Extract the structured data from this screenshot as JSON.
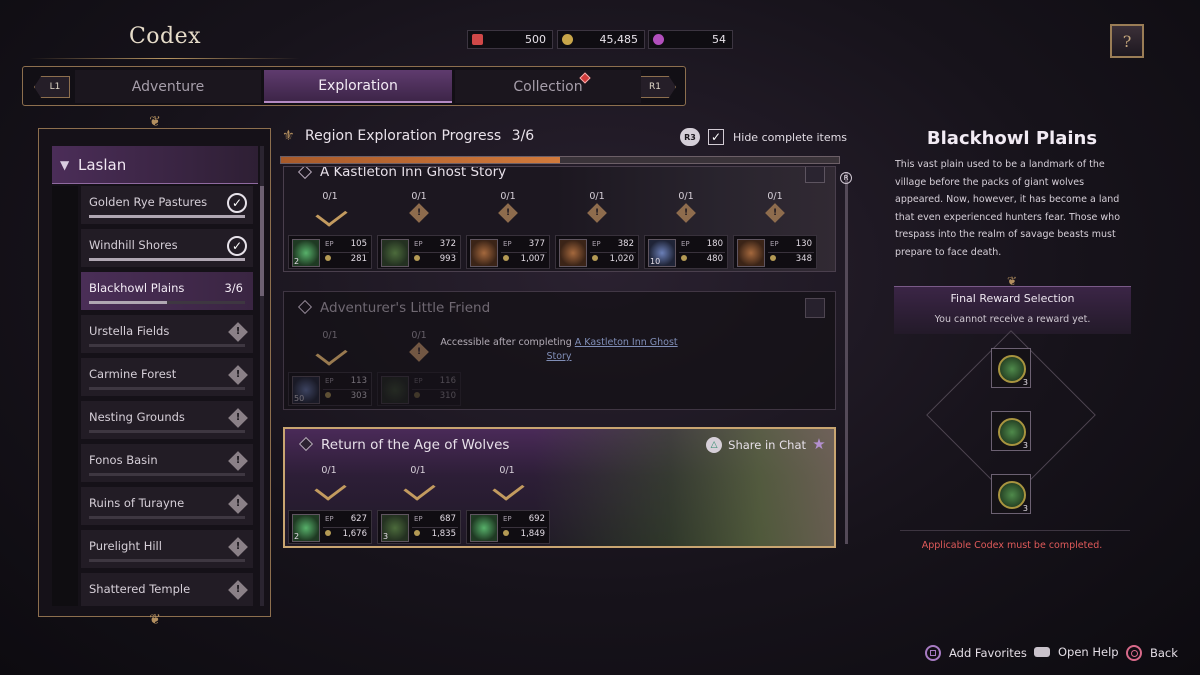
{
  "header": {
    "title": "Codex",
    "currencies": [
      {
        "icon": "flag-icon",
        "value": "500",
        "color": "#d04848"
      },
      {
        "icon": "gil-coin-icon",
        "value": "45,485",
        "color": "#c8a64a"
      },
      {
        "icon": "gem-icon",
        "value": "54",
        "color": "#b24fbd"
      }
    ],
    "help_icon": "help-book-icon"
  },
  "tabs": {
    "left_shoulder": "L1",
    "right_shoulder": "R1",
    "items": [
      {
        "label": "Adventure"
      },
      {
        "label": "Exploration"
      },
      {
        "label": "Collection"
      }
    ]
  },
  "sidebar": {
    "region": "Laslan",
    "items": [
      {
        "label": "Golden Rye Pastures",
        "status": "complete",
        "progress": 1.0
      },
      {
        "label": "Windhill Shores",
        "status": "complete",
        "progress": 1.0
      },
      {
        "label": "Blackhowl Plains",
        "status": "selected",
        "count": "3/6",
        "progress": 0.5
      },
      {
        "label": "Urstella Fields",
        "status": "locked",
        "progress": 0
      },
      {
        "label": "Carmine Forest",
        "status": "locked",
        "progress": 0
      },
      {
        "label": "Nesting Grounds",
        "status": "locked",
        "progress": 0
      },
      {
        "label": "Fonos Basin",
        "status": "locked",
        "progress": 0
      },
      {
        "label": "Ruins of Turayne",
        "status": "locked",
        "progress": 0
      },
      {
        "label": "Purelight Hill",
        "status": "locked",
        "progress": 0
      },
      {
        "label": "Shattered Temple",
        "status": "locked",
        "progress": 0
      }
    ]
  },
  "main": {
    "progress_label": "Region Exploration Progress",
    "progress_count": "3/6",
    "progress_fraction": 0.5,
    "hide_button": "R3",
    "hide_label": "Hide complete items",
    "scroll_cap": "R",
    "cards": [
      {
        "title": "A Kastleton Inn Ghost Story",
        "milestones": [
          "0/1",
          "0/1",
          "0/1",
          "0/1",
          "0/1",
          "0/1"
        ],
        "rewards": [
          {
            "qty": "2",
            "exp": "105",
            "gil": "281"
          },
          {
            "qty": "",
            "exp": "372",
            "gil": "993"
          },
          {
            "qty": "",
            "exp": "377",
            "gil": "1,007"
          },
          {
            "qty": "",
            "exp": "382",
            "gil": "1,020"
          },
          {
            "qty": "10",
            "exp": "180",
            "gil": "480"
          },
          {
            "qty": "",
            "exp": "130",
            "gil": "348"
          }
        ]
      },
      {
        "title": "Adventurer's Little Friend",
        "milestones": [
          "0/1",
          "0/1"
        ],
        "locked_prefix": "Accessible after completing",
        "locked_link": "A Kastleton Inn Ghost Story",
        "rewards": [
          {
            "qty": "50",
            "exp": "113",
            "gil": "303"
          },
          {
            "qty": "",
            "exp": "116",
            "gil": "310"
          }
        ]
      },
      {
        "title": "Return of the Age of Wolves",
        "share_label": "Share in Chat",
        "milestones": [
          "0/1",
          "0/1",
          "0/1"
        ],
        "rewards": [
          {
            "qty": "2",
            "exp": "627",
            "gil": "1,676"
          },
          {
            "qty": "3",
            "exp": "687",
            "gil": "1,835"
          },
          {
            "qty": "",
            "exp": "692",
            "gil": "1,849"
          }
        ]
      }
    ]
  },
  "detail": {
    "title": "Blackhowl Plains",
    "description": "This vast plain used to be a landmark of the village before the packs of giant wolves appeared. Now, however, it has become a land that even experienced hunters fear. Those who trespass into the realm of savage beasts must prepare to face death.",
    "final_reward_title": "Final Reward Selection",
    "final_reward_status": "You cannot receive a reward yet.",
    "final_rewards": [
      {
        "icon": "crossed-tools-badge-icon",
        "qty": "3"
      },
      {
        "icon": "armor-badge-icon",
        "qty": "3"
      },
      {
        "icon": "ring-badge-icon",
        "qty": "3"
      }
    ],
    "warning": "Applicable Codex must be completed."
  },
  "footer": [
    {
      "label": "Add Favorites",
      "button": "square-button-icon",
      "color": "#a77bc3"
    },
    {
      "label": "Open Help",
      "button": "touchpad-button-icon",
      "color": "#c9c2cb"
    },
    {
      "label": "Back",
      "button": "circle-button-icon",
      "color": "#d86a8a"
    }
  ]
}
